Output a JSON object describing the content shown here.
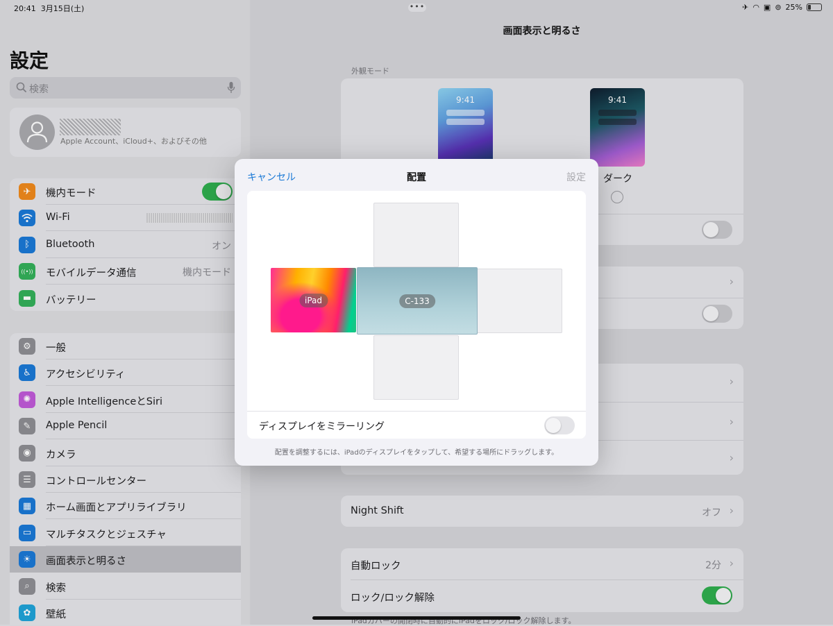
{
  "status_bar": {
    "time": "20:41",
    "date": "3月15日(土)",
    "battery": "25%",
    "multitask_dots": "•••"
  },
  "sidebar": {
    "title": "設定",
    "search_placeholder": "検索",
    "account_subtitle": "Apple Account、iCloud+、およびその他",
    "group1": [
      {
        "label": "機内モード",
        "icon": "airplane-icon",
        "color": "#f08a1c",
        "glyph": "✈",
        "toggle": true
      },
      {
        "label": "Wi-Fi",
        "icon": "wifi-icon",
        "color": "#1a79d6",
        "glyph": "",
        "value": ""
      },
      {
        "label": "Bluetooth",
        "icon": "bluetooth-icon",
        "color": "#1a79d6",
        "glyph": "ᛒ",
        "value": "オン"
      },
      {
        "label": "モバイルデータ通信",
        "icon": "antenna-icon",
        "color": "#34b05a",
        "glyph": "((•))",
        "value": "機内モード"
      },
      {
        "label": "バッテリー",
        "icon": "battery-icon",
        "color": "#34b05a",
        "glyph": "▬"
      }
    ],
    "group2": [
      {
        "label": "一般",
        "icon": "gear-icon",
        "color": "#8e8e93",
        "glyph": "⚙"
      },
      {
        "label": "アクセシビリティ",
        "icon": "accessibility-icon",
        "color": "#1a79d6",
        "glyph": "♿"
      },
      {
        "label": "Apple IntelligenceとSiri",
        "icon": "siri-icon",
        "color": "#c05ad8",
        "glyph": "✺"
      },
      {
        "label": "Apple Pencil",
        "icon": "pencil-icon",
        "color": "#8e8e93",
        "glyph": "✎"
      },
      {
        "label": "カメラ",
        "icon": "camera-icon",
        "color": "#8e8e93",
        "glyph": "◉"
      },
      {
        "label": "コントロールセンター",
        "icon": "switches-icon",
        "color": "#8e8e93",
        "glyph": "☰"
      },
      {
        "label": "ホーム画面とアプリライブラリ",
        "icon": "home-screen-icon",
        "color": "#1a79d6",
        "glyph": "▦"
      },
      {
        "label": "マルチタスクとジェスチャ",
        "icon": "multitask-icon",
        "color": "#1a79d6",
        "glyph": "▭"
      },
      {
        "label": "画面表示と明るさ",
        "icon": "sun-icon",
        "color": "#1a79d6",
        "glyph": "☀",
        "selected": true
      },
      {
        "label": "検索",
        "icon": "magnifier-icon",
        "color": "#8e8e93",
        "glyph": "⌕"
      },
      {
        "label": "壁紙",
        "icon": "flower-icon",
        "color": "#1fa3d8",
        "glyph": "✿"
      }
    ]
  },
  "main": {
    "title": "画面表示と明るさ",
    "appearance_label": "外観モード",
    "preview_time": "9:41",
    "dark_label": "ダーク",
    "night_shift_label": "Night Shift",
    "night_shift_value": "オフ",
    "auto_lock_label": "自動ロック",
    "auto_lock_value": "2分",
    "lock_unlock_label": "ロック/ロック解除",
    "bottom_footnote": "iPadカバーの開閉時に自動的にiPadをロック/ロック解除します。"
  },
  "modal": {
    "cancel": "キャンセル",
    "title": "配置",
    "done": "設定",
    "ipad_label": "iPad",
    "external_label": "C-133",
    "mirroring_label": "ディスプレイをミラーリング",
    "footnote": "配置を調整するには、iPadのディスプレイをタップして、希望する場所にドラッグします。"
  }
}
